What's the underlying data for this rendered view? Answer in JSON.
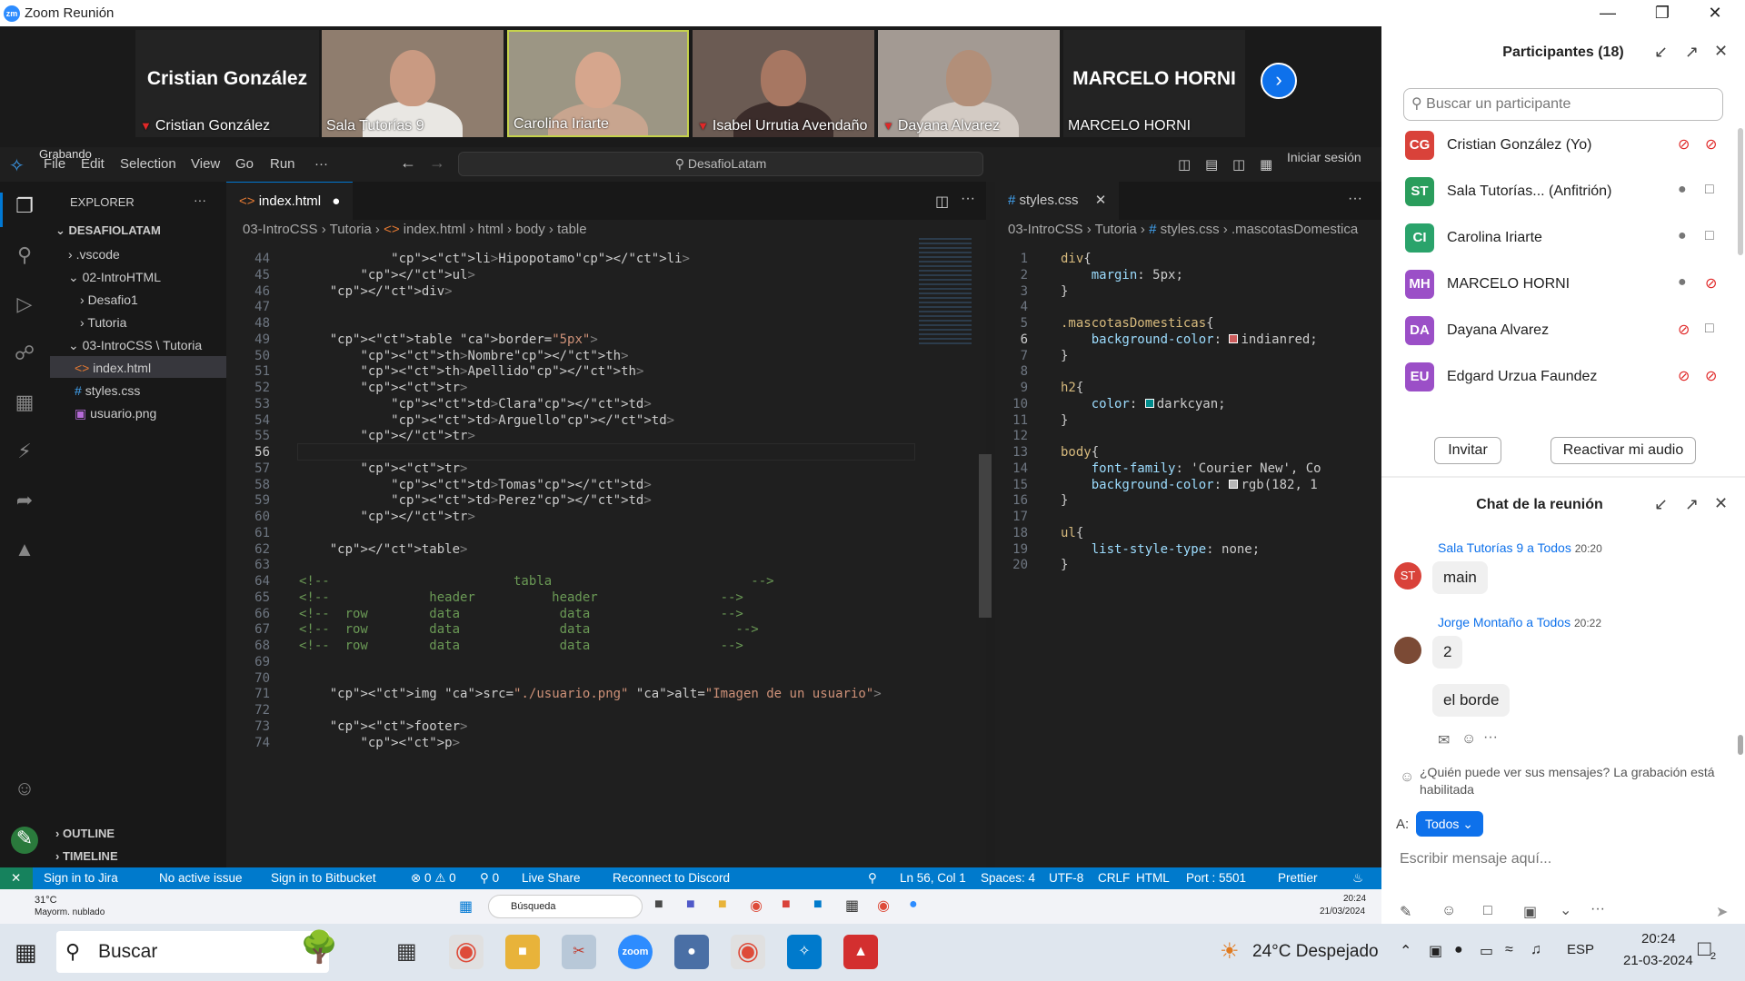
{
  "zoom": {
    "title": "Zoom Reunión",
    "logo": "zm",
    "participants": [
      {
        "name": "Cristian González",
        "label": "Cristian González",
        "muted": true
      },
      {
        "name": "Sala Tutorías 9",
        "muted": false
      },
      {
        "name": "Carolina Iriarte",
        "muted": false
      },
      {
        "name": "Isabel Urrutia Avendaño",
        "muted": true
      },
      {
        "name": "Dayana Alvarez",
        "muted": true
      },
      {
        "name": "MARCELO HORNI",
        "label": "MARCELO HORNI",
        "muted": false
      }
    ]
  },
  "vscode": {
    "recording": "Grabando",
    "menu": [
      "File",
      "Edit",
      "Selection",
      "View",
      "Go",
      "Run",
      "···"
    ],
    "command_center": "DesafioLatam",
    "sign_in": "Iniciar sesión",
    "explorer": {
      "header": "EXPLORER",
      "root": "DESAFIOLATAM",
      "items": [
        ".vscode",
        "02-IntroHTML",
        "Desafio1",
        "Tutoria",
        "03-IntroCSS \\ Tutoria",
        "index.html",
        "styles.css",
        "usuario.png"
      ],
      "outline": "OUTLINE",
      "timeline": "TIMELINE"
    },
    "left_tab": "index.html",
    "left_crumbs": [
      "03-IntroCSS",
      "Tutoria",
      "index.html",
      "html",
      "body",
      "table"
    ],
    "right_tab": "styles.css",
    "right_crumbs": [
      "03-IntroCSS",
      "Tutoria",
      "#",
      "styles.css",
      ".mascotasDomestica"
    ],
    "html_lines": [
      {
        "n": "44",
        "t": "            <li>Hipopotamo</li>"
      },
      {
        "n": "45",
        "t": "        </ul>"
      },
      {
        "n": "46",
        "t": "    </div>"
      },
      {
        "n": "47",
        "t": ""
      },
      {
        "n": "48",
        "t": ""
      },
      {
        "n": "49",
        "t": "    <table border=\"5px\">"
      },
      {
        "n": "50",
        "t": "        <th>Nombre</th>"
      },
      {
        "n": "51",
        "t": "        <th>Apellido</th>"
      },
      {
        "n": "52",
        "t": "        <tr>"
      },
      {
        "n": "53",
        "t": "            <td>Clara</td>"
      },
      {
        "n": "54",
        "t": "            <td>Arguello</td>"
      },
      {
        "n": "55",
        "t": "        </tr>"
      },
      {
        "n": "56",
        "t": ""
      },
      {
        "n": "57",
        "t": "        <tr>"
      },
      {
        "n": "58",
        "t": "            <td>Tomas</td>"
      },
      {
        "n": "59",
        "t": "            <td>Perez</td>"
      },
      {
        "n": "60",
        "t": "        </tr>"
      },
      {
        "n": "61",
        "t": ""
      },
      {
        "n": "62",
        "t": "    </table>"
      },
      {
        "n": "63",
        "t": ""
      },
      {
        "n": "64",
        "t": "<!--                        tabla                          -->"
      },
      {
        "n": "65",
        "t": "<!--             header          header                -->"
      },
      {
        "n": "66",
        "t": "<!--  row        data             data                 -->"
      },
      {
        "n": "67",
        "t": "<!--  row        data             data                   -->"
      },
      {
        "n": "68",
        "t": "<!--  row        data             data                 -->"
      },
      {
        "n": "69",
        "t": ""
      },
      {
        "n": "70",
        "t": ""
      },
      {
        "n": "71",
        "t": "    <img src=\"./usuario.png\" alt=\"Imagen de un usuario\">"
      },
      {
        "n": "72",
        "t": ""
      },
      {
        "n": "73",
        "t": "    <footer>"
      },
      {
        "n": "74",
        "t": "        <p>"
      }
    ],
    "css_lines": [
      {
        "n": "1",
        "t": "div{"
      },
      {
        "n": "2",
        "t": "    margin: 5px;"
      },
      {
        "n": "3",
        "t": "}"
      },
      {
        "n": "4",
        "t": ""
      },
      {
        "n": "5",
        "t": ".mascotasDomesticas{"
      },
      {
        "n": "6",
        "t": "    background-color: ▪indianred;"
      },
      {
        "n": "7",
        "t": "}"
      },
      {
        "n": "8",
        "t": ""
      },
      {
        "n": "9",
        "t": "h2{"
      },
      {
        "n": "10",
        "t": "    color: ▪darkcyan;"
      },
      {
        "n": "11",
        "t": "}"
      },
      {
        "n": "12",
        "t": ""
      },
      {
        "n": "13",
        "t": "body{"
      },
      {
        "n": "14",
        "t": "    font-family: 'Courier New', Co"
      },
      {
        "n": "15",
        "t": "    background-color: ▪rgb(182, 1"
      },
      {
        "n": "16",
        "t": "}"
      },
      {
        "n": "17",
        "t": ""
      },
      {
        "n": "18",
        "t": "ul{"
      },
      {
        "n": "19",
        "t": "    list-style-type: none;"
      },
      {
        "n": "20",
        "t": "}"
      }
    ],
    "status": {
      "jira": "Sign in to Jira",
      "issue": "No active issue",
      "bitbucket": "Sign in to Bitbucket",
      "problems": "⊗ 0 ⚠ 0",
      "ports": "⚲ 0",
      "liveshare": "Live Share",
      "discord": "Reconnect to Discord",
      "position": "Ln 56, Col 1",
      "spaces": "Spaces: 4",
      "encoding": "UTF-8",
      "eol": "CRLF",
      "lang": "HTML",
      "port": "Port : 5501",
      "prettier": "Prettier"
    },
    "inner_taskbar": {
      "temp": "31°C",
      "weather": "Mayorm. nublado",
      "search": "Búsqueda",
      "time": "20:24",
      "date": "21/03/2024"
    }
  },
  "panel": {
    "participants_title": "Participantes (18)",
    "search_placeholder": "Buscar un participante",
    "list": [
      {
        "initials": "CG",
        "name": "Cristian González (Yo)",
        "color": "#d9423a"
      },
      {
        "initials": "ST",
        "name": "Sala Tutorías... (Anfitrión)",
        "color": "#2a9d5c"
      },
      {
        "initials": "CI",
        "name": "Carolina Iriarte",
        "color": "#2aa36b"
      },
      {
        "initials": "MH",
        "name": "MARCELO HORNI",
        "color": "#9b4fc7"
      },
      {
        "initials": "DA",
        "name": "Dayana Alvarez",
        "color": "#9b4fc7"
      },
      {
        "initials": "EU",
        "name": "Edgard Urzua Faundez",
        "color": "#9b4fc7"
      }
    ],
    "invite": "Invitar",
    "reactivate": "Reactivar mi audio",
    "chat_title": "Chat de la reunión",
    "messages": [
      {
        "from": "Sala Tutorías 9",
        "to": "a Todos",
        "time": "20:20",
        "text": "main"
      },
      {
        "from": "Jorge Montaño",
        "to": "a Todos",
        "time": "20:22",
        "text": "2"
      },
      {
        "text": "el borde"
      }
    ],
    "privacy": "¿Quién puede ver sus mensajes? La grabación está habilitada",
    "to_label": "A:",
    "to_value": "Todos",
    "input_placeholder": "Escribir mensaje aquí..."
  },
  "taskbar": {
    "search": "Buscar",
    "weather": "24°C  Despejado",
    "lang": "ESP",
    "time": "20:24",
    "date": "21-03-2024",
    "notifications": "2"
  }
}
